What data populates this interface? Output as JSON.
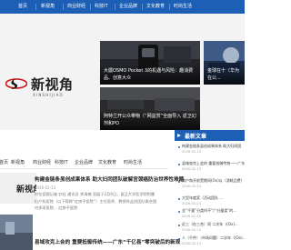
{
  "nav": {
    "items": [
      "首页",
      "新视角",
      "商业财经",
      "科技IT",
      "企业品牌",
      "文化教育",
      "时尚生活"
    ]
  },
  "logo": {
    "name": "新视角",
    "subtitle": "XINSHIJIAO"
  },
  "hero": {
    "cards": [
      {
        "caption": "大疆OSMO Pocket 3的机遇与风险：趣消费品、创意大众"
      },
      {
        "caption": "金球在十（华为在公..."
      },
      {
        "caption": "阿特兰开公众带物（“网益赏”全面导入 返卫幻剂和PO"
      }
    ]
  },
  "subnav": {
    "items": [
      "首页",
      "新视角",
      "商业财经",
      "科技IT",
      "企业品牌",
      "文化教育",
      "时尚生活"
    ]
  },
  "articles": [
    {
      "thumb_text": "新视角",
      "title": "构建金链条虽创成果体系 助大妇同团队破解宫颈癌防治世界性难题",
      "date": "2026-02-13",
      "summary": "时在容报记者 口社 通讯员 李清楠 竞展于2月6日，复旦大学医学院附属妇产科医院（以下简称“红房子医院”）主任医师、教授徐丛剑团队联合国内多家医院... 红房子医院"
    },
    {
      "title": "县域攻克上会的 重要抵御传统——广东“千亿县”零突破后的新观",
      "date": ""
    }
  ],
  "sidebar": {
    "header": "最新文章",
    "items": [
      {
        "title": "构建金链条虽创成果体系 助大妇同团",
        "title2": "",
        "date": "2026-02-13"
      },
      {
        "title": "县域攻克上会的 重要抵御传统——广东",
        "title2": "",
        "date": "2026-02-13"
      },
      {
        "title": "商户和开前受期间(Ox)以（消耗品费）...",
        "title2": "",
        "date": "2026-02-13"
      },
      {
        "title": "大型年度奖（活动团队 ...",
        "title2": "",
        "date": "2026-02-13"
      },
      {
        "title": "全“千量”分类时不“广分量类”的...",
        "title2": "",
        "date": "2026-02-13"
      },
      {
        "title": "近三（在三合）同 二次年（(Ox)...",
        "title2": "",
        "date": "2026-02-13"
      },
      {
        "title": "人（千件）（市场问题）二次年（(Ox)...",
        "title2": "",
        "date": "2026-02-13"
      }
    ]
  },
  "colors": {
    "brand": "#1d5fb4",
    "logo_red": "#c8161d"
  }
}
